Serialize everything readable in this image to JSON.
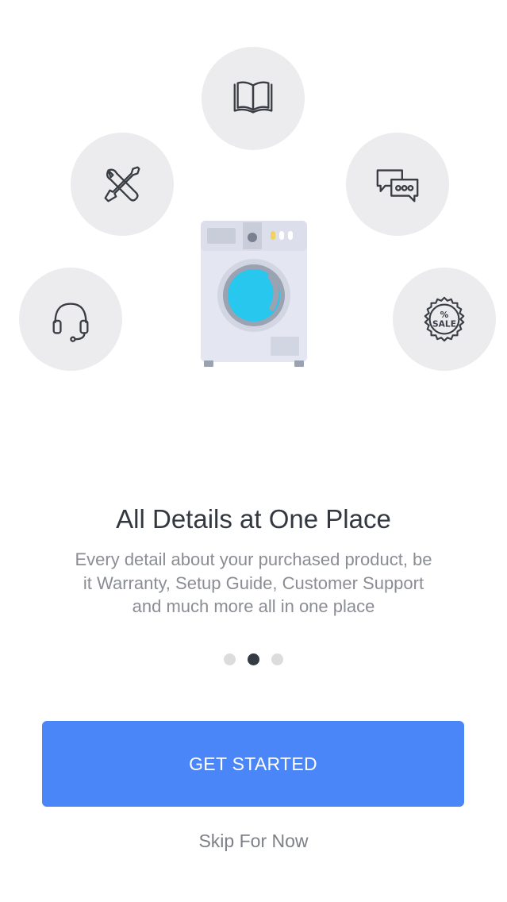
{
  "illustration": {
    "icons": [
      "book-icon",
      "tools-icon",
      "chat-icon",
      "headset-icon",
      "sale-tag-icon",
      "washing-machine-icon"
    ],
    "sale_tag": {
      "percent": "%",
      "text": "SALE"
    },
    "colors": {
      "circle_bg": "#ececee",
      "icon_stroke": "#3a3d44",
      "washer_body": "#e4e7f1",
      "washer_drum": "#28c7ee"
    }
  },
  "content": {
    "title": "All Details at One Place",
    "description_lines": [
      "Every detail about your purchased product, be",
      "it Warranty, Setup Guide, Customer Support",
      "and much more all in one place"
    ]
  },
  "pager": {
    "total": 3,
    "active_index": 1
  },
  "actions": {
    "primary_label": "GET STARTED",
    "secondary_label": "Skip For Now"
  },
  "colors": {
    "accent": "#4a86f7",
    "title_text": "#33373f",
    "body_text": "#8a8d93",
    "dot_active": "#363a45",
    "dot_inactive": "#dcdcdf"
  }
}
